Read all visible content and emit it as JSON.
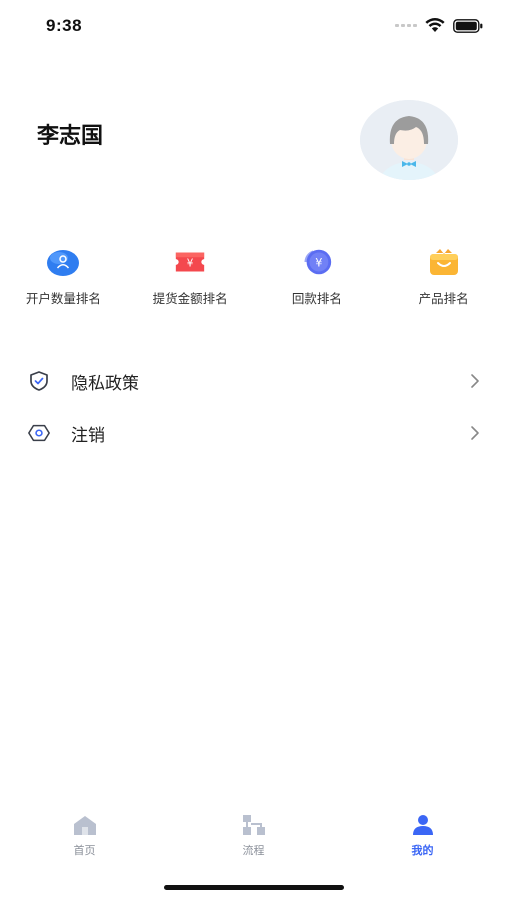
{
  "status_bar": {
    "time": "9:38"
  },
  "profile": {
    "name": "李志国"
  },
  "quick_actions": [
    {
      "label": "开户数量排名",
      "icon": "user-rank-icon"
    },
    {
      "label": "提货金额排名",
      "icon": "ticket-yen-icon"
    },
    {
      "label": "回款排名",
      "icon": "coin-yen-icon"
    },
    {
      "label": "产品排名",
      "icon": "gift-box-icon"
    }
  ],
  "menu": [
    {
      "label": "隐私政策",
      "icon": "shield-check-icon"
    },
    {
      "label": "注销",
      "icon": "eye-hexagon-icon"
    }
  ],
  "tabbar": [
    {
      "label": "首页",
      "icon": "home-icon",
      "active": false
    },
    {
      "label": "流程",
      "icon": "flow-icon",
      "active": false
    },
    {
      "label": "我的",
      "icon": "person-icon",
      "active": true
    }
  ],
  "colors": {
    "accent": "#3b66f5",
    "inactive_tab": "#8a8f99"
  }
}
